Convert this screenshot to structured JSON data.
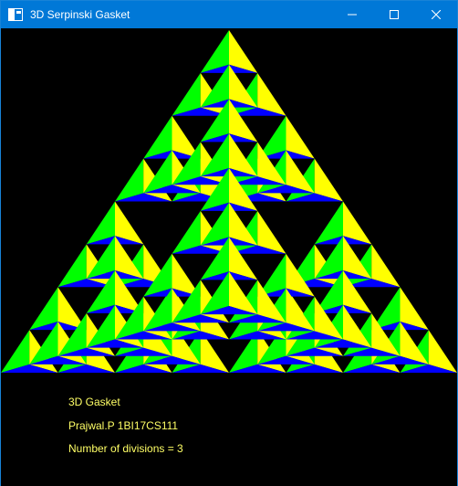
{
  "window": {
    "title": "3D Serpinski Gasket",
    "icon": "app-window-icon",
    "controls": [
      "minimize-icon",
      "maximize-icon",
      "close-icon"
    ]
  },
  "gasket": {
    "divisions": 3,
    "face_colors": {
      "left": "#00ff00",
      "right": "#ffff00",
      "bottom": "#0000ff",
      "background": "#000000"
    }
  },
  "info": {
    "title": "3D Gasket",
    "author": "Prajwal.P 1BI17CS111",
    "divisions_text": "Number of divisions = 3",
    "text_color": "#ffff66"
  },
  "colors": {
    "titlebar": "#0078d7",
    "titlebar_text": "#ffffff"
  }
}
